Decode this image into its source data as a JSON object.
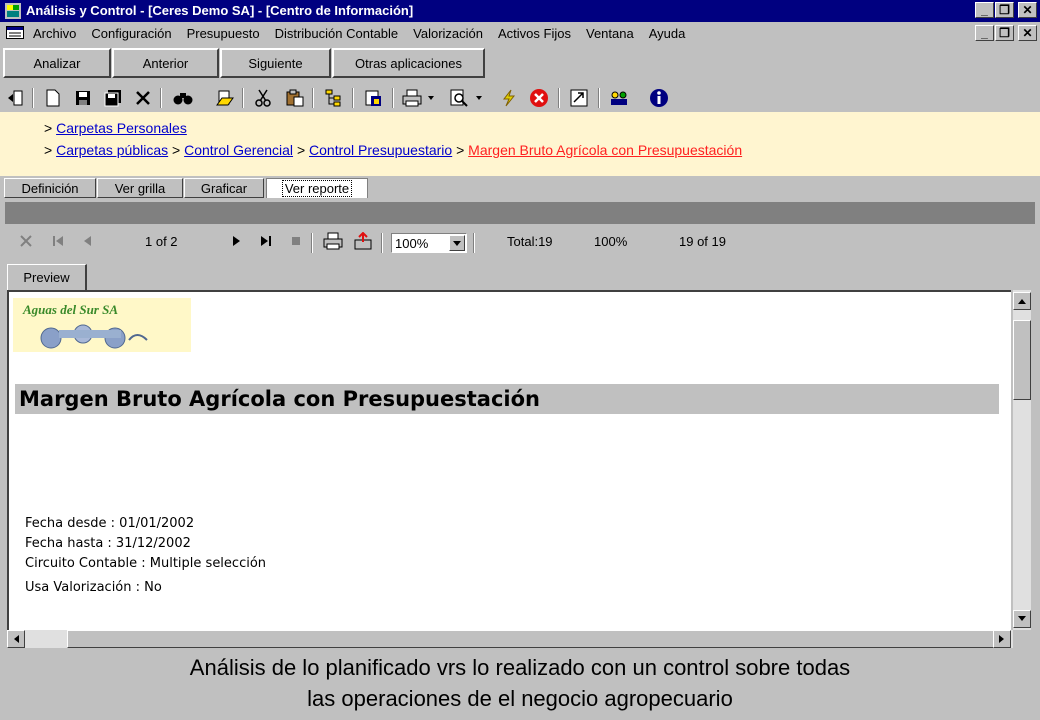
{
  "window": {
    "title": "Análisis y Control - [Ceres Demo SA] - [Centro de Información]",
    "controls": [
      "_",
      "❐",
      "✕"
    ]
  },
  "menu": {
    "items": [
      "Archivo",
      "Configuración",
      "Presupuesto",
      "Distribución Contable",
      "Valorización",
      "Activos Fijos",
      "Ventana",
      "Ayuda"
    ]
  },
  "commands": {
    "analizar": "Analizar",
    "anterior": "Anterior",
    "siguiente": "Siguiente",
    "otras": "Otras aplicaciones"
  },
  "toolbar": {
    "icons": [
      "back-icon",
      "new-icon",
      "save-icon",
      "save-all-icon",
      "delete-icon",
      "find-icon",
      "open-folder-icon",
      "cut-icon",
      "paste-icon",
      "tree-icon",
      "properties-icon",
      "print-icon",
      "print-preview-icon",
      "run-icon",
      "stop-icon",
      "export-icon",
      "users-icon",
      "info-icon"
    ]
  },
  "breadcrumbs": {
    "line1": {
      "prefix": ">",
      "link": "Carpetas Personales"
    },
    "line2": {
      "prefix": ">",
      "links": [
        "Carpetas públicas",
        "Control Gerencial",
        "Control Presupuestario"
      ],
      "separator": ">",
      "current": "Margen Bruto Agrícola con Presupuestación"
    },
    "background": "#fff5d0",
    "link_color": "#0000cc",
    "current_color": "#ff2020"
  },
  "tabs": [
    "Definición",
    "Ver grilla",
    "Graficar",
    "Ver reporte"
  ],
  "active_tab": "Ver reporte",
  "viewer": {
    "page_indicator": "1 of 2",
    "zoom": "100%",
    "total": "Total:19",
    "percent": "100%",
    "records": "19 of 19",
    "preview_tab": "Preview"
  },
  "report": {
    "logo_text": "Aguas del Sur SA",
    "title": "Margen Bruto Agrícola con Presupuestación",
    "params": [
      "Fecha desde : 01/01/2002",
      "Fecha hasta : 31/12/2002",
      "Circuito Contable : Multiple selección",
      "Usa Valorización : No"
    ]
  },
  "caption": {
    "line1": "Análisis de lo planificado vrs lo realizado con un control sobre todas",
    "line2": "las operaciones de el negocio agropecuario"
  }
}
